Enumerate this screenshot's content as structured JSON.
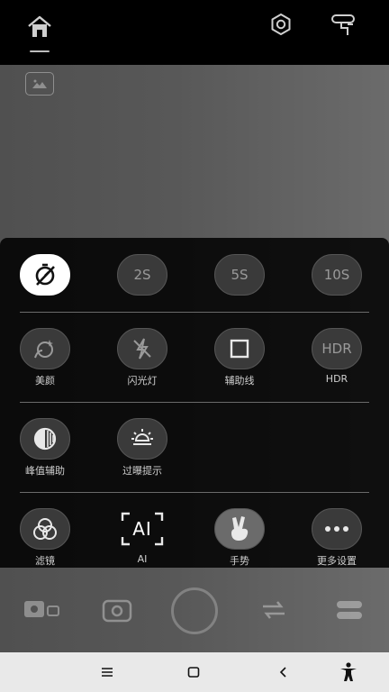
{
  "top_bar": {
    "home_icon": "home-icon",
    "settings_icon": "gear-icon",
    "device_icon": "gimbal-icon"
  },
  "timer_row": {
    "off_icon": "timer-off-icon",
    "options": [
      "2S",
      "5S",
      "10S"
    ]
  },
  "controls": [
    {
      "label": "美颜",
      "icon": "beauty-icon"
    },
    {
      "label": "闪光灯",
      "icon": "flash-off-icon"
    },
    {
      "label": "辅助线",
      "icon": "grid-square-icon"
    },
    {
      "label": "HDR",
      "button_text": "HDR"
    },
    {
      "label": "峰值辅助",
      "icon": "peaking-icon"
    },
    {
      "label": "过曝提示",
      "icon": "exposure-sun-icon"
    },
    {
      "label": "滤镜",
      "icon": "filter-circles-icon"
    },
    {
      "label": "AI",
      "button_text": "AI"
    },
    {
      "label": "手势",
      "icon": "gesture-hand-icon"
    },
    {
      "label": "更多设置",
      "icon": "more-dots-icon"
    }
  ],
  "nav_bar": {
    "menu": "menu-icon",
    "home": "square-home-icon",
    "back": "back-icon",
    "accessibility": "accessibility-icon"
  },
  "colors": {
    "panel": "#000000",
    "button": "#3a3a3a",
    "active": "#ffffff",
    "navbar": "#e9e9e9"
  }
}
